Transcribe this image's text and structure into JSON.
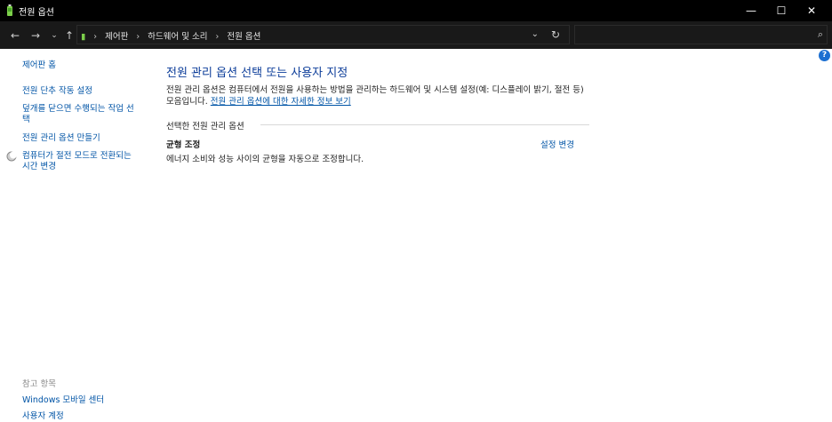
{
  "window": {
    "title": "전원 옵션",
    "controls": [
      "minimize",
      "maximize",
      "close"
    ]
  },
  "address": {
    "breadcrumb": [
      "제어판",
      "하드웨어 및 소리",
      "전원 옵션"
    ],
    "search_placeholder": ""
  },
  "sidebar": {
    "home": "제어판 홈",
    "items": [
      "전원 단추 작동 설정",
      "덮개를 닫으면 수행되는 작업 선택",
      "전원 관리 옵션 만들기",
      "컴퓨터가 절전 모드로 전환되는 시간 변경"
    ],
    "see_also_title": "참고 항목",
    "see_also_items": [
      "Windows 모바일 센터",
      "사용자 계정"
    ]
  },
  "main": {
    "heading": "전원 관리 옵션 선택 또는 사용자 지정",
    "intro_text": "전원 관리 옵션은 컴퓨터에서 전원을 사용하는 방법을 관리하는 하드웨어 및 시스템 설정(예: 디스플레이 밝기, 절전 등) 모음입니다.",
    "intro_link": "전원 관리 옵션에 대한 자세한 정보 보기",
    "section_title": "선택한 전원 관리 옵션",
    "plan_name": "균형 조정",
    "plan_description": "에너지 소비와 성능 사이의 균형을 자동으로 조정합니다.",
    "plan_link": "설정 변경"
  }
}
